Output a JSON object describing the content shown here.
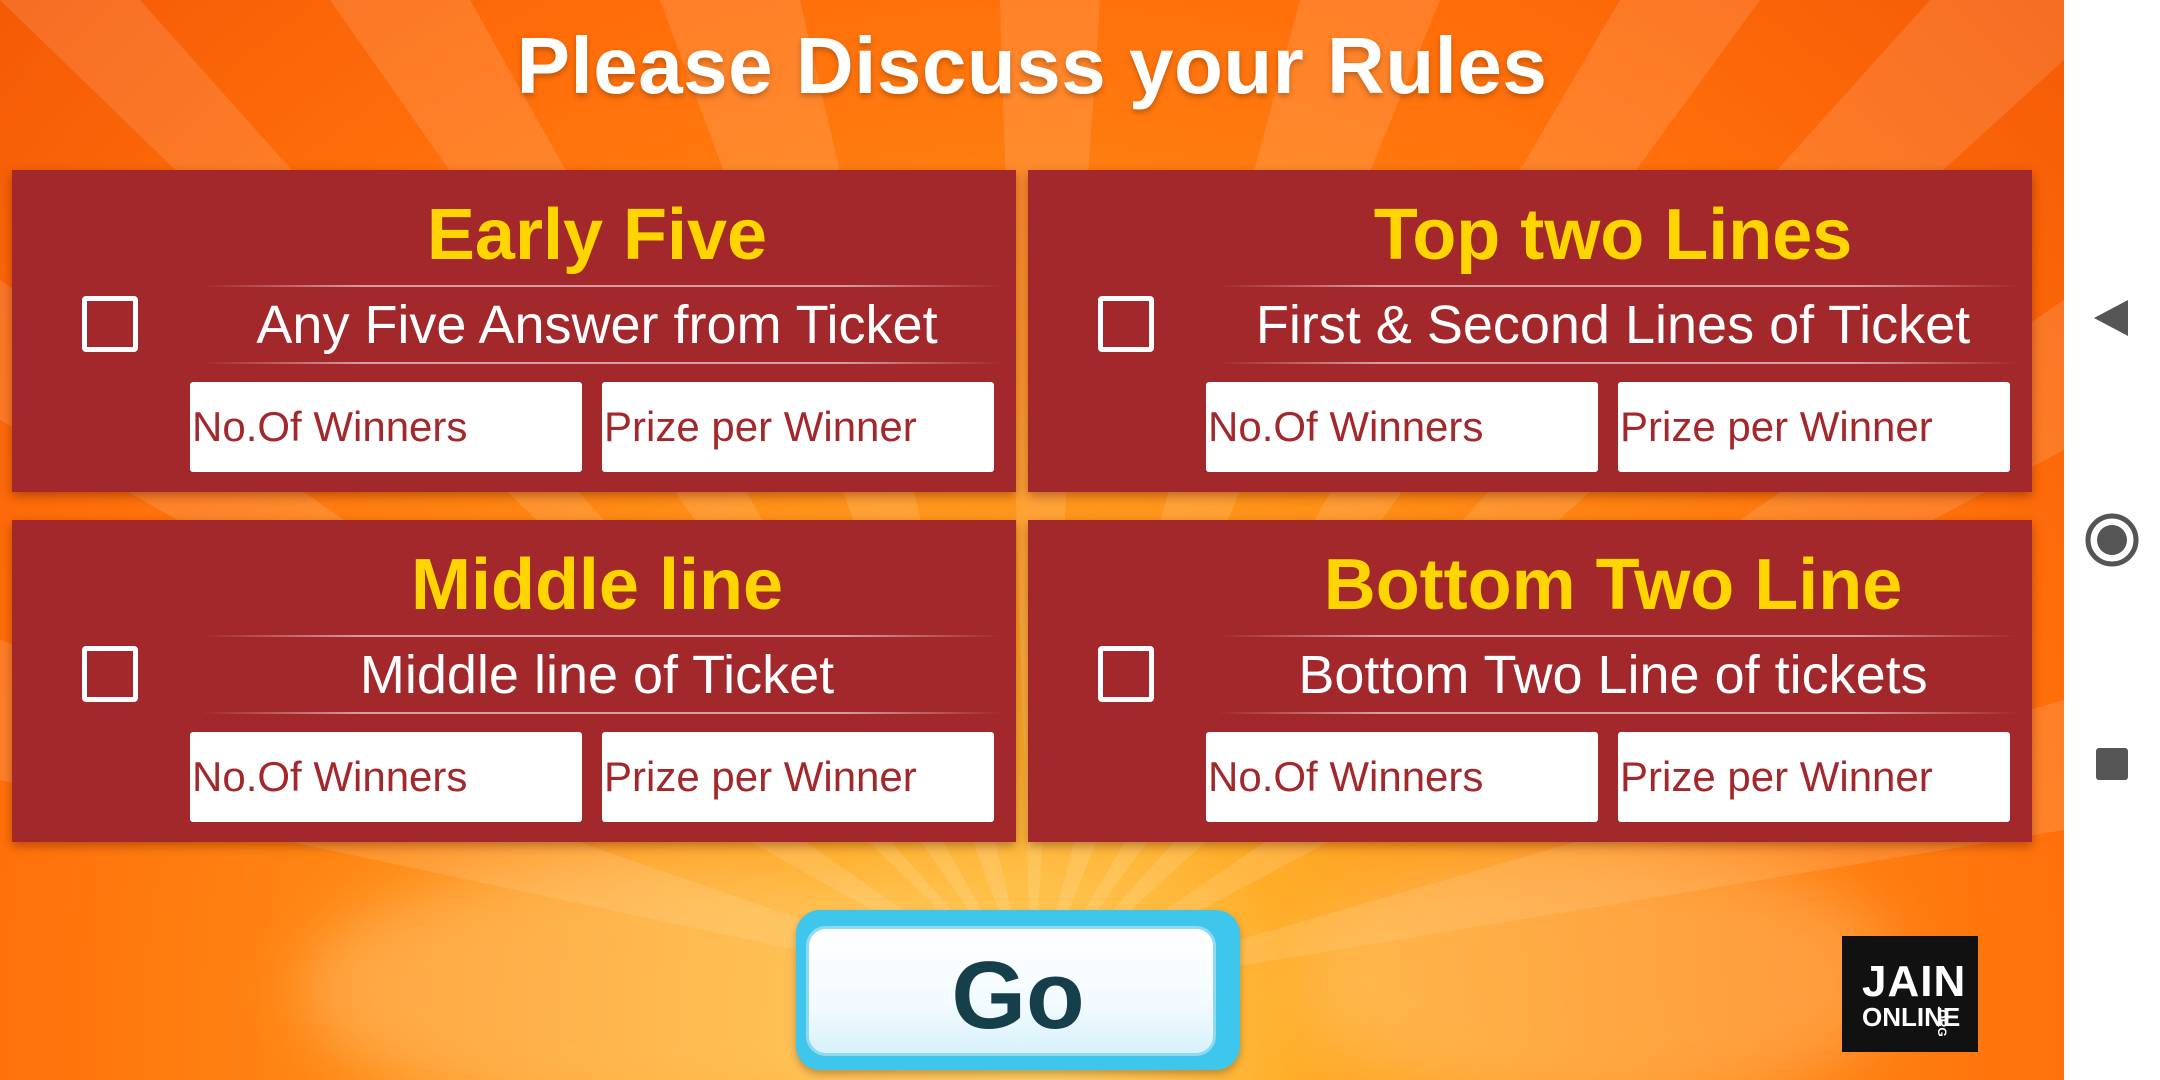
{
  "screen": {
    "title": "Please Discuss your Rules"
  },
  "rules": [
    {
      "title": "Early Five",
      "description": "Any Five Answer from Ticket",
      "winners_placeholder": "No.Of Winners",
      "prize_placeholder": "Prize per Winner"
    },
    {
      "title": "Top two Lines",
      "description": "First & Second Lines of Ticket",
      "winners_placeholder": "No.Of Winners",
      "prize_placeholder": "Prize per Winner"
    },
    {
      "title": "Middle line",
      "description": "Middle line of Ticket",
      "winners_placeholder": "No.Of Winners",
      "prize_placeholder": "Prize per Winner"
    },
    {
      "title": "Bottom Two Line",
      "description": "Bottom Two Line of tickets",
      "winners_placeholder": "No.Of Winners",
      "prize_placeholder": "Prize per Winner"
    }
  ],
  "go_button": {
    "label": "Go"
  },
  "logo": {
    "line1": "JAIN",
    "line2": "ONLINE",
    "line3": ".ORG"
  },
  "nav": {
    "back_icon": "back-triangle-icon",
    "home_icon": "home-circle-icon",
    "recents_icon": "recents-square-icon"
  },
  "colors": {
    "card_background": "#a3282c",
    "card_title": "#ffd500",
    "field_text": "#a3282c",
    "go_button_border": "#3fc6ec",
    "go_label": "#163f4c",
    "background": "#ff8a14"
  }
}
